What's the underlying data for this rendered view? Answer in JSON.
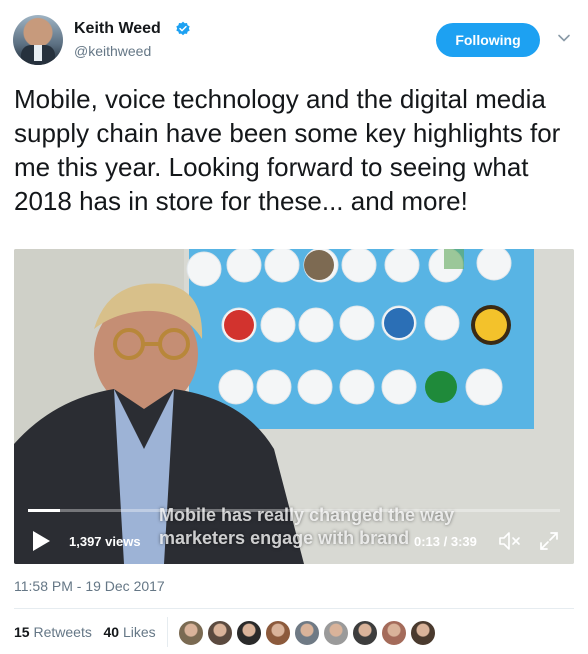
{
  "header": {
    "name": "Keith Weed",
    "handle": "@keithweed",
    "verified_icon": "verified-badge-icon",
    "follow_label": "Following",
    "menu_icon": "chevron-down-icon"
  },
  "tweet": {
    "text": "Mobile, voice technology and the digital media supply chain have been some key highlights for me this year. Looking forward to seeing what 2018 has in store for these... and more!"
  },
  "video": {
    "caption_line1": "Mobile has really changed the way",
    "caption_line2": "marketers engage with brand",
    "views": "1,397 views",
    "time": "0:13 / 3:39",
    "progress": 0.06,
    "play_icon": "play-icon",
    "mute_icon": "mute-icon",
    "fullscreen_icon": "fullscreen-icon"
  },
  "timestamp": "11:58 PM - 19 Dec 2017",
  "stats": {
    "retweets_count": "15",
    "retweets_label": "Retweets",
    "likes_count": "40",
    "likes_label": "Likes"
  },
  "likers": [
    {
      "color": "#7a6a52"
    },
    {
      "color": "#5b4a3f"
    },
    {
      "color": "#2a2a2a"
    },
    {
      "color": "#8c5a3c"
    },
    {
      "color": "#6f7a85"
    },
    {
      "color": "#9a9a9a"
    },
    {
      "color": "#3d3d3d"
    },
    {
      "color": "#a46b5a"
    },
    {
      "color": "#4a3a2e"
    }
  ],
  "colors": {
    "accent": "#1da1f2",
    "secondary_text": "#657786"
  }
}
